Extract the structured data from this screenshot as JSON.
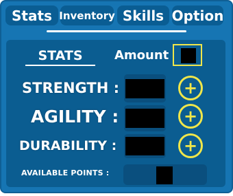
{
  "tabs": [
    {
      "label": "Stats"
    },
    {
      "label": "Inventory"
    },
    {
      "label": "Skills"
    },
    {
      "label": "Option"
    }
  ],
  "section": {
    "title": "STATS"
  },
  "amount": {
    "label": "Amount :",
    "value": ""
  },
  "stats": [
    {
      "label": "STRENGTH :",
      "value": ""
    },
    {
      "label": "AGILITY :",
      "value": ""
    },
    {
      "label": "DURABILITY :",
      "value": ""
    }
  ],
  "plus_symbol": "+",
  "available_points": {
    "label": "AVAILABLE POINTS :",
    "value": ""
  },
  "colors": {
    "panel": "#1675b3",
    "inner": "#0b5d91",
    "accent": "#f0e64a"
  }
}
